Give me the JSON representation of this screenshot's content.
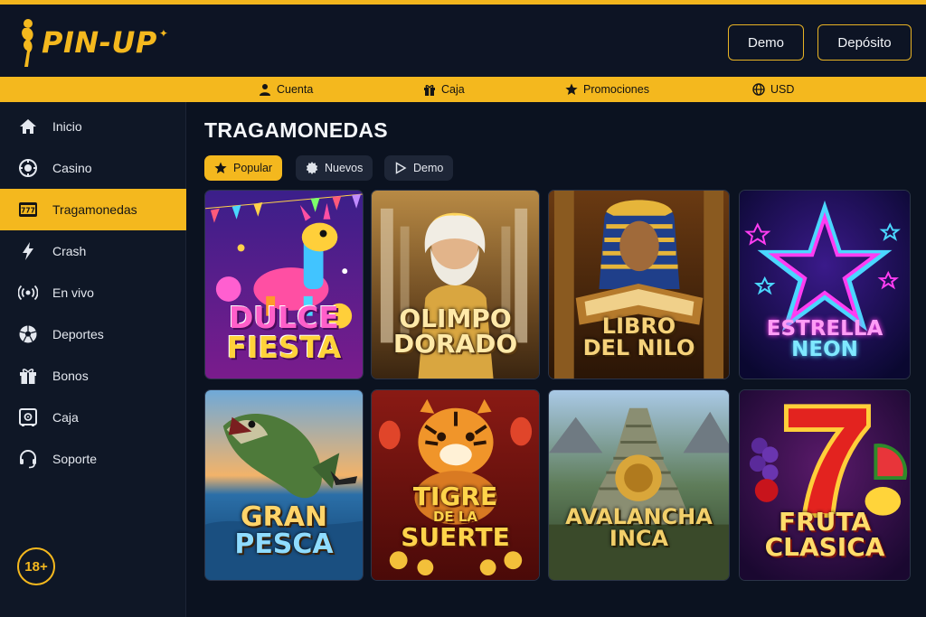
{
  "header": {
    "logo_text": "PIN-UP",
    "demo_label": "Demo",
    "deposit_label": "Depósito"
  },
  "topnav": [
    {
      "label": "Cuenta",
      "icon": "user-icon"
    },
    {
      "label": "Caja",
      "icon": "gift-icon"
    },
    {
      "label": "Promociones",
      "icon": "star-icon"
    },
    {
      "label": "USD",
      "icon": "globe-icon"
    }
  ],
  "sidebar": {
    "items": [
      {
        "label": "Inicio",
        "icon": "home-icon"
      },
      {
        "label": "Casino",
        "icon": "casino-chip-icon"
      },
      {
        "label": "Tragamonedas",
        "icon": "slot-777-icon",
        "active": true
      },
      {
        "label": "Crash",
        "icon": "lightning-icon"
      },
      {
        "label": "En vivo",
        "icon": "live-broadcast-icon"
      },
      {
        "label": "Deportes",
        "icon": "soccer-ball-icon"
      },
      {
        "label": "Bonos",
        "icon": "gift-icon"
      },
      {
        "label": "Caja",
        "icon": "safe-icon"
      },
      {
        "label": "Soporte",
        "icon": "headset-icon"
      }
    ],
    "age_badge": "18+"
  },
  "main": {
    "title": "TRAGAMONEDAS",
    "filters": [
      {
        "label": "Popular",
        "icon": "star-icon",
        "active": true
      },
      {
        "label": "Nuevos",
        "icon": "gear-badge-icon",
        "active": false
      },
      {
        "label": "Demo",
        "icon": "play-icon",
        "active": false
      }
    ],
    "games": [
      {
        "line1": "DULCE",
        "line2": "FIESTA"
      },
      {
        "line1": "OLIMPO",
        "line2": "DORADO"
      },
      {
        "line1": "LIBRO",
        "line2": "DEL NILO"
      },
      {
        "line1": "ESTRELLA",
        "line2": "NEON"
      },
      {
        "line1": "GRAN",
        "line2": "PESCA"
      },
      {
        "line1": "TIGRE",
        "line2": "DE LA",
        "line3": "SUERTE"
      },
      {
        "line1": "AVALANCHA",
        "line2": "INCA"
      },
      {
        "line1": "FRUTA",
        "line2": "CLASICA"
      }
    ]
  },
  "colors": {
    "accent": "#f4b81e",
    "background": "#0b1220",
    "sidebar": "#0f1726"
  }
}
